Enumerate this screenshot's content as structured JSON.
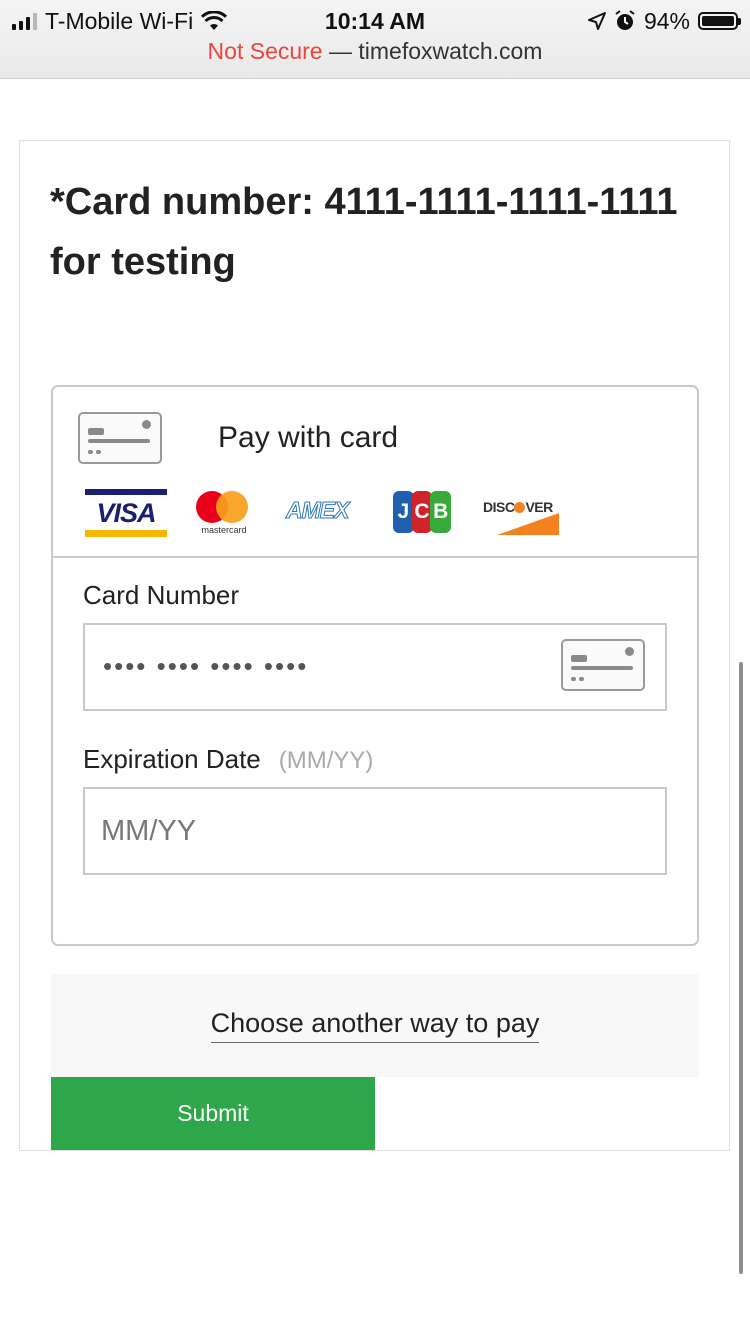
{
  "status_bar": {
    "carrier": "T-Mobile Wi-Fi",
    "time": "10:14 AM",
    "battery": "94%",
    "battery_level": 0.94,
    "security_label": "Not Secure",
    "separator": "—",
    "domain": "timefoxwatch.com"
  },
  "page": {
    "testing_note": "*Card number: 4111-1111-1111-1111 for testing"
  },
  "payment": {
    "title": "Pay with card",
    "brands": [
      {
        "name": "visa-logo",
        "text": "VISA"
      },
      {
        "name": "mastercard-logo",
        "text": "mastercard"
      },
      {
        "name": "amex-logo",
        "text": "AMEX"
      },
      {
        "name": "jcb-logo",
        "text": "JCB"
      },
      {
        "name": "discover-logo",
        "text": "DISCOVER"
      }
    ],
    "card_number_label": "Card Number",
    "card_number_value": "•••• •••• •••• ••••",
    "expiration_label": "Expiration Date",
    "expiration_hint": "(MM/YY)",
    "expiration_placeholder": "MM/YY",
    "alt_pay_link": "Choose another way to pay",
    "submit_label": "Submit"
  },
  "colors": {
    "submit_green": "#2ea64a",
    "warning_red": "#e8463e"
  }
}
